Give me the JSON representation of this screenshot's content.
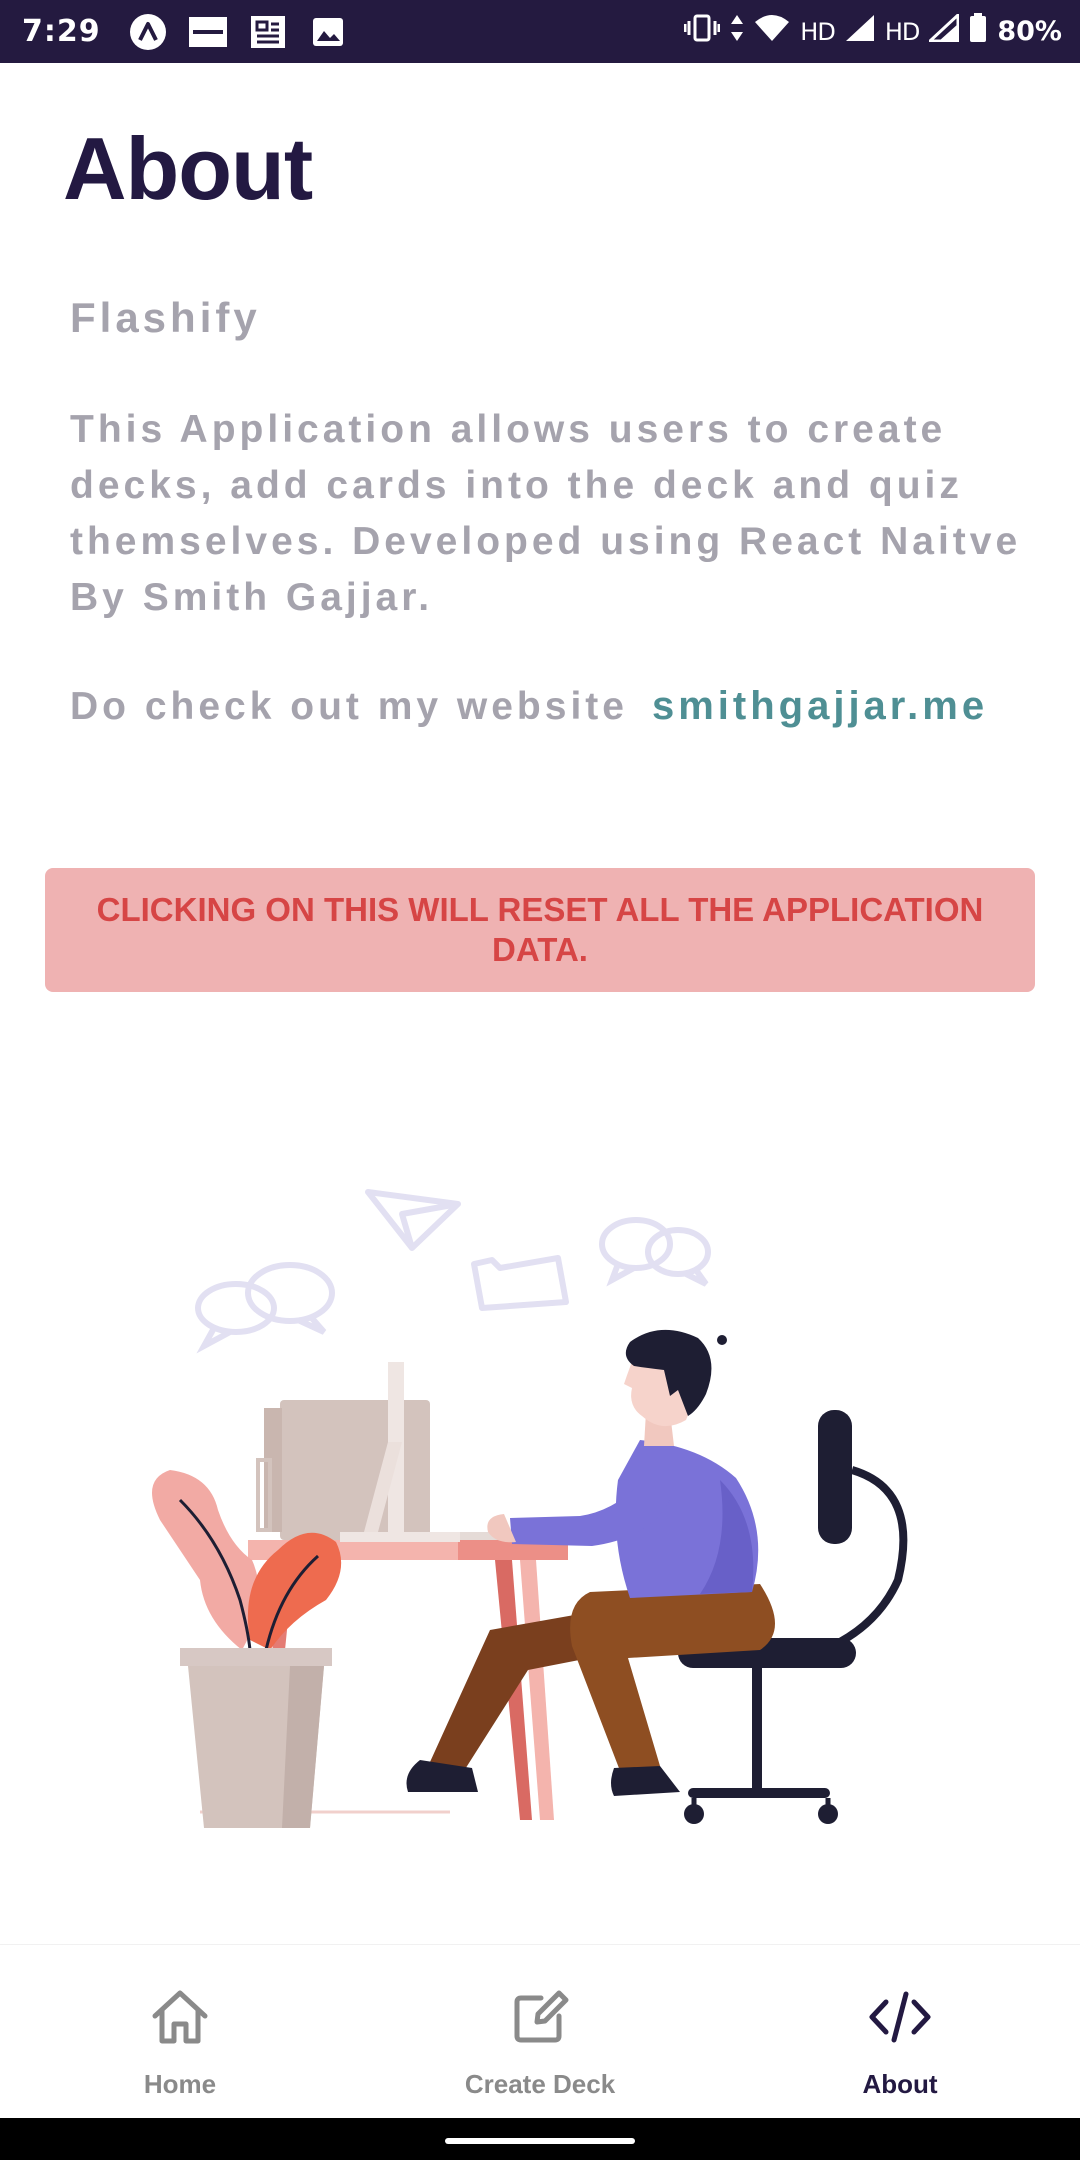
{
  "status_bar": {
    "time": "7:29",
    "notification_icons": [
      "expo-icon",
      "zomato-icon",
      "news-icon",
      "gallery-icon"
    ],
    "hd_label_1": "HD",
    "hd_label_2": "HD",
    "battery": "80%"
  },
  "page": {
    "title": "About",
    "app_name": "Flashify",
    "description": "This Application allows users to create decks, add cards into the deck and quiz themselves. Developed using React Naitve By Smith Gajjar.",
    "website_prompt": "Do check out my website",
    "website_link": "smithgajjar.me"
  },
  "reset": {
    "label": "CLICKING ON THIS WILL RESET ALL THE APPLICATION DATA."
  },
  "nav": {
    "items": [
      {
        "label": "Home",
        "icon": "home-icon",
        "active": false
      },
      {
        "label": "Create Deck",
        "icon": "edit-icon",
        "active": false
      },
      {
        "label": "About",
        "icon": "code-icon",
        "active": true
      }
    ]
  },
  "colors": {
    "status_bar_bg": "#241a40",
    "title": "#231942",
    "muted_text": "#a5a3ad",
    "link": "#4f8f94",
    "reset_bg": "#efb2b2",
    "reset_text": "#d64545",
    "nav_active": "#231942",
    "nav_inactive": "#8a8a8a"
  }
}
